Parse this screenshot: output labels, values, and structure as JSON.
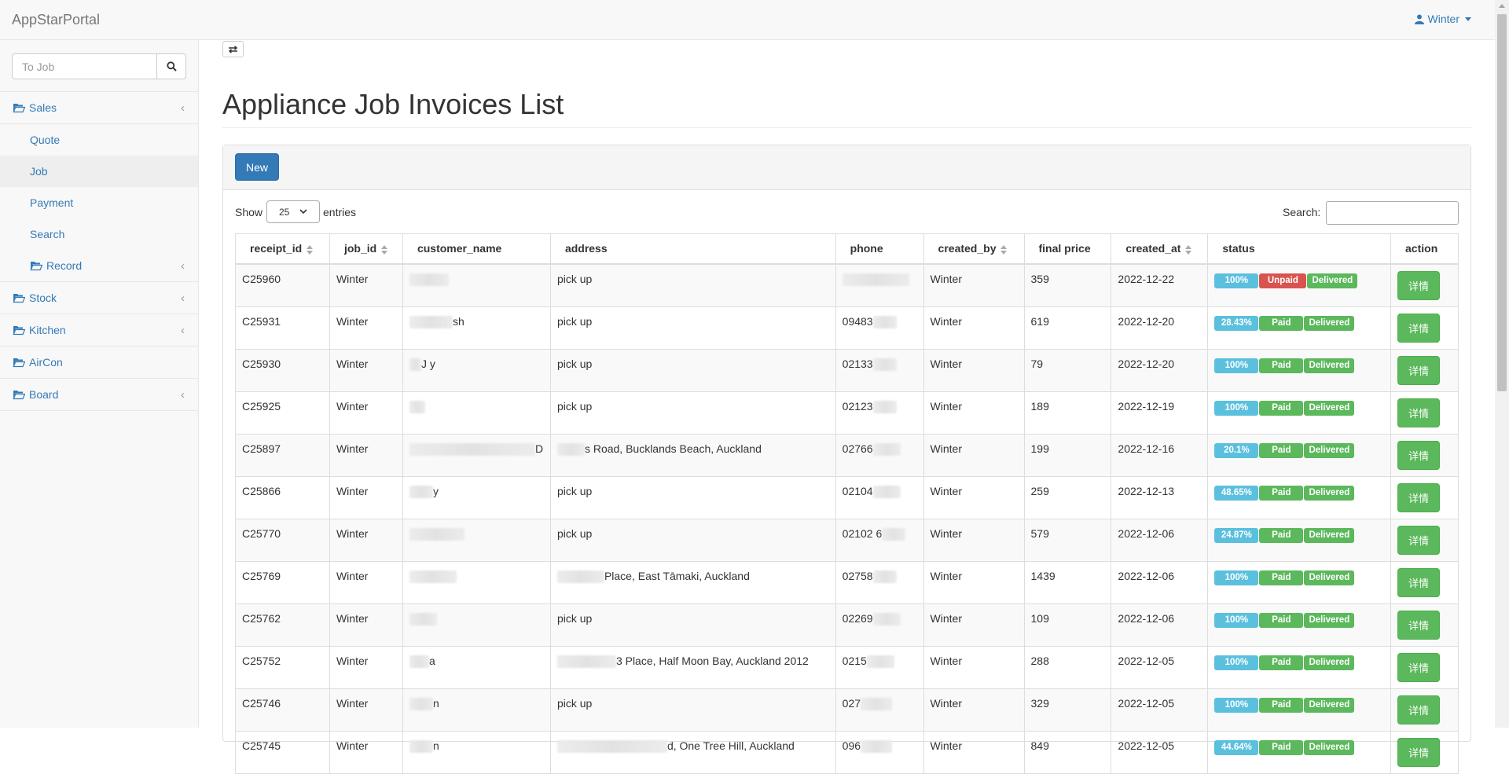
{
  "navbar": {
    "brand": "AppStarPortal",
    "user": "Winter"
  },
  "sidebar": {
    "search_placeholder": "To Job",
    "items": [
      {
        "label": "Sales",
        "has_children": true
      },
      {
        "label": "Quote"
      },
      {
        "label": "Job",
        "active": true
      },
      {
        "label": "Payment"
      },
      {
        "label": "Search"
      },
      {
        "label": "Record",
        "has_children": true
      },
      {
        "label": "Stock",
        "has_children": true
      },
      {
        "label": "Kitchen",
        "has_children": true
      },
      {
        "label": "AirCon"
      },
      {
        "label": "Board",
        "has_children": true
      }
    ]
  },
  "main": {
    "title": "Appliance Job Invoices List",
    "new_label": "New",
    "show_label": "Show",
    "page_length": "25",
    "entries_label": "entries",
    "search_label": "Search:",
    "columns": [
      "receipt_id",
      "job_id",
      "customer_name",
      "address",
      "phone",
      "created_by",
      "final price",
      "created_at",
      "status",
      "action"
    ],
    "rows": [
      {
        "receipt_id": "C25960",
        "job_id": "Winter",
        "customer_name": "",
        "address": "pick up",
        "phone": "",
        "created_by": "Winter",
        "final_price": "359",
        "created_at": "2022-12-22",
        "progress": "100%",
        "payment": "Unpaid",
        "delivery": "Delivered",
        "action": "详情"
      },
      {
        "receipt_id": "C25931",
        "job_id": "Winter",
        "customer_name": "sh",
        "address": "pick up",
        "phone": "09483",
        "created_by": "Winter",
        "final_price": "619",
        "created_at": "2022-12-20",
        "progress": "28.43%",
        "payment": "Paid",
        "delivery": "Delivered",
        "action": "详情"
      },
      {
        "receipt_id": "C25930",
        "job_id": "Winter",
        "customer_name": "J y",
        "address": "pick up",
        "phone": "02133",
        "created_by": "Winter",
        "final_price": "79",
        "created_at": "2022-12-20",
        "progress": "100%",
        "payment": "Paid",
        "delivery": "Delivered",
        "action": "详情"
      },
      {
        "receipt_id": "C25925",
        "job_id": "Winter",
        "customer_name": "",
        "address": "pick up",
        "phone": "02123",
        "created_by": "Winter",
        "final_price": "189",
        "created_at": "2022-12-19",
        "progress": "100%",
        "payment": "Paid",
        "delivery": "Delivered",
        "action": "详情"
      },
      {
        "receipt_id": "C25897",
        "job_id": "Winter",
        "customer_name": "D",
        "address": "s Road, Bucklands Beach, Auckland",
        "phone": "02766",
        "created_by": "Winter",
        "final_price": "199",
        "created_at": "2022-12-16",
        "progress": "20.1%",
        "payment": "Paid",
        "delivery": "Delivered",
        "action": "详情"
      },
      {
        "receipt_id": "C25866",
        "job_id": "Winter",
        "customer_name": "y",
        "address": "pick up",
        "phone": "02104",
        "created_by": "Winter",
        "final_price": "259",
        "created_at": "2022-12-13",
        "progress": "48.65%",
        "payment": "Paid",
        "delivery": "Delivered",
        "action": "详情"
      },
      {
        "receipt_id": "C25770",
        "job_id": "Winter",
        "customer_name": "",
        "address": "pick up",
        "phone": "02102 6",
        "created_by": "Winter",
        "final_price": "579",
        "created_at": "2022-12-06",
        "progress": "24.87%",
        "payment": "Paid",
        "delivery": "Delivered",
        "action": "详情"
      },
      {
        "receipt_id": "C25769",
        "job_id": "Winter",
        "customer_name": "",
        "address": "Place, East Tāmaki, Auckland",
        "phone": "02758",
        "created_by": "Winter",
        "final_price": "1439",
        "created_at": "2022-12-06",
        "progress": "100%",
        "payment": "Paid",
        "delivery": "Delivered",
        "action": "详情"
      },
      {
        "receipt_id": "C25762",
        "job_id": "Winter",
        "customer_name": "",
        "address": "pick up",
        "phone": "02269",
        "created_by": "Winter",
        "final_price": "109",
        "created_at": "2022-12-06",
        "progress": "100%",
        "payment": "Paid",
        "delivery": "Delivered",
        "action": "详情"
      },
      {
        "receipt_id": "C25752",
        "job_id": "Winter",
        "customer_name": "a",
        "address": "3 Place, Half Moon Bay, Auckland 2012",
        "phone": "0215",
        "created_by": "Winter",
        "final_price": "288",
        "created_at": "2022-12-05",
        "progress": "100%",
        "payment": "Paid",
        "delivery": "Delivered",
        "action": "详情"
      },
      {
        "receipt_id": "C25746",
        "job_id": "Winter",
        "customer_name": "n",
        "address": "pick up",
        "phone": "027",
        "created_by": "Winter",
        "final_price": "329",
        "created_at": "2022-12-05",
        "progress": "100%",
        "payment": "Paid",
        "delivery": "Delivered",
        "action": "详情"
      },
      {
        "receipt_id": "C25745",
        "job_id": "Winter",
        "customer_name": "n",
        "address": "d, One Tree Hill, Auckland",
        "phone": "096",
        "created_by": "Winter",
        "final_price": "849",
        "created_at": "2022-12-05",
        "progress": "44.64%",
        "payment": "Paid",
        "delivery": "Delivered",
        "action": "详情"
      }
    ]
  },
  "colors": {
    "primary": "#337ab7",
    "info": "#5bc0de",
    "success": "#5cb85c",
    "danger": "#d9534f"
  },
  "icons": [
    "user-icon",
    "search-icon",
    "folder-open-icon",
    "chevron-left-icon",
    "toggle-arrows-icon",
    "sort-icon",
    "caret-down-icon"
  ]
}
